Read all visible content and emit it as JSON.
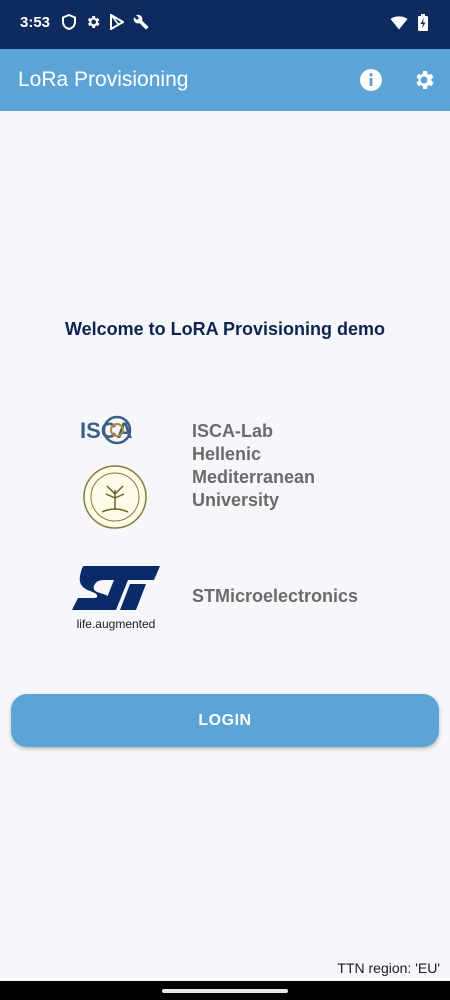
{
  "status_bar": {
    "time": "3:53",
    "icons_left": [
      "shield-outline-icon",
      "gear-icon",
      "play-store-icon",
      "wrench-icon"
    ],
    "icons_right": [
      "wifi-icon",
      "battery-charging-icon"
    ],
    "background": "#0e2a5e"
  },
  "app_bar": {
    "title": "LoRa Provisioning",
    "actions": [
      "info-icon",
      "settings-gear-icon"
    ],
    "background": "#5da4d6"
  },
  "main": {
    "welcome": "Welcome to LoRA Provisioning demo",
    "orgs": [
      {
        "lines": [
          "ISCA-Lab",
          "Hellenic",
          "Mediterranean",
          "University"
        ],
        "logos": [
          "isca-logo",
          "hmu-seal-logo"
        ]
      },
      {
        "lines": [
          "STMicroelectronics"
        ],
        "logos": [
          "st-logo"
        ],
        "logo_text": "life.augmented"
      }
    ],
    "isca_logo_text": "ISCA",
    "login_label": "LOGIN",
    "accent": "#5da4d6",
    "welcome_color": "#0e2350"
  },
  "footer": {
    "region": "TTN region: 'EU'"
  }
}
